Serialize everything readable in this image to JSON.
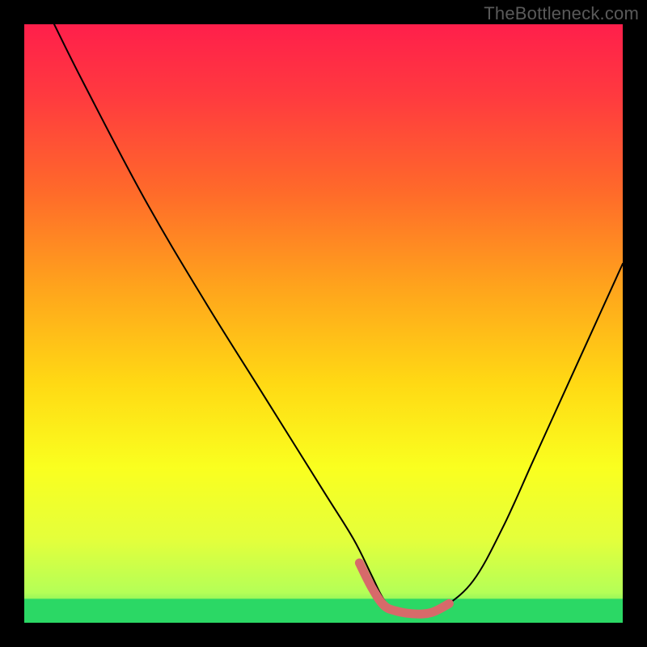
{
  "watermark": {
    "text": "TheBottleneck.com"
  },
  "chart_data": {
    "type": "line",
    "title": "",
    "xlabel": "",
    "ylabel": "",
    "xlim": [
      0,
      100
    ],
    "ylim": [
      0,
      100
    ],
    "equal_band": {
      "y_from": 0,
      "y_to": 4,
      "color": "#2bd865"
    },
    "series": [
      {
        "name": "bottleneck-curve",
        "type": "line",
        "color": "#000000",
        "x": [
          5,
          10,
          20,
          30,
          40,
          50,
          55,
          58,
          60,
          62,
          65,
          68,
          70,
          75,
          80,
          85,
          90,
          95,
          100
        ],
        "values": [
          100,
          90,
          71,
          54,
          38,
          22,
          14,
          8,
          4,
          2,
          1.5,
          1.7,
          2.5,
          7,
          16,
          27,
          38,
          49,
          60
        ]
      },
      {
        "name": "highlighted-optimal-range",
        "type": "line",
        "color": "#d76a6a",
        "x": [
          56,
          58,
          60,
          62,
          65,
          68,
          71
        ],
        "values": [
          10,
          6,
          3,
          2,
          1.5,
          1.7,
          3.2
        ]
      }
    ],
    "gradient_stops": [
      {
        "offset": 0.0,
        "color": "#ff1f4b"
      },
      {
        "offset": 0.12,
        "color": "#ff3a3f"
      },
      {
        "offset": 0.28,
        "color": "#ff6a2a"
      },
      {
        "offset": 0.44,
        "color": "#ffa41c"
      },
      {
        "offset": 0.6,
        "color": "#ffd914"
      },
      {
        "offset": 0.74,
        "color": "#faff1f"
      },
      {
        "offset": 0.86,
        "color": "#e4ff3b"
      },
      {
        "offset": 0.95,
        "color": "#b4ff57"
      },
      {
        "offset": 1.0,
        "color": "#2bd865"
      }
    ]
  }
}
